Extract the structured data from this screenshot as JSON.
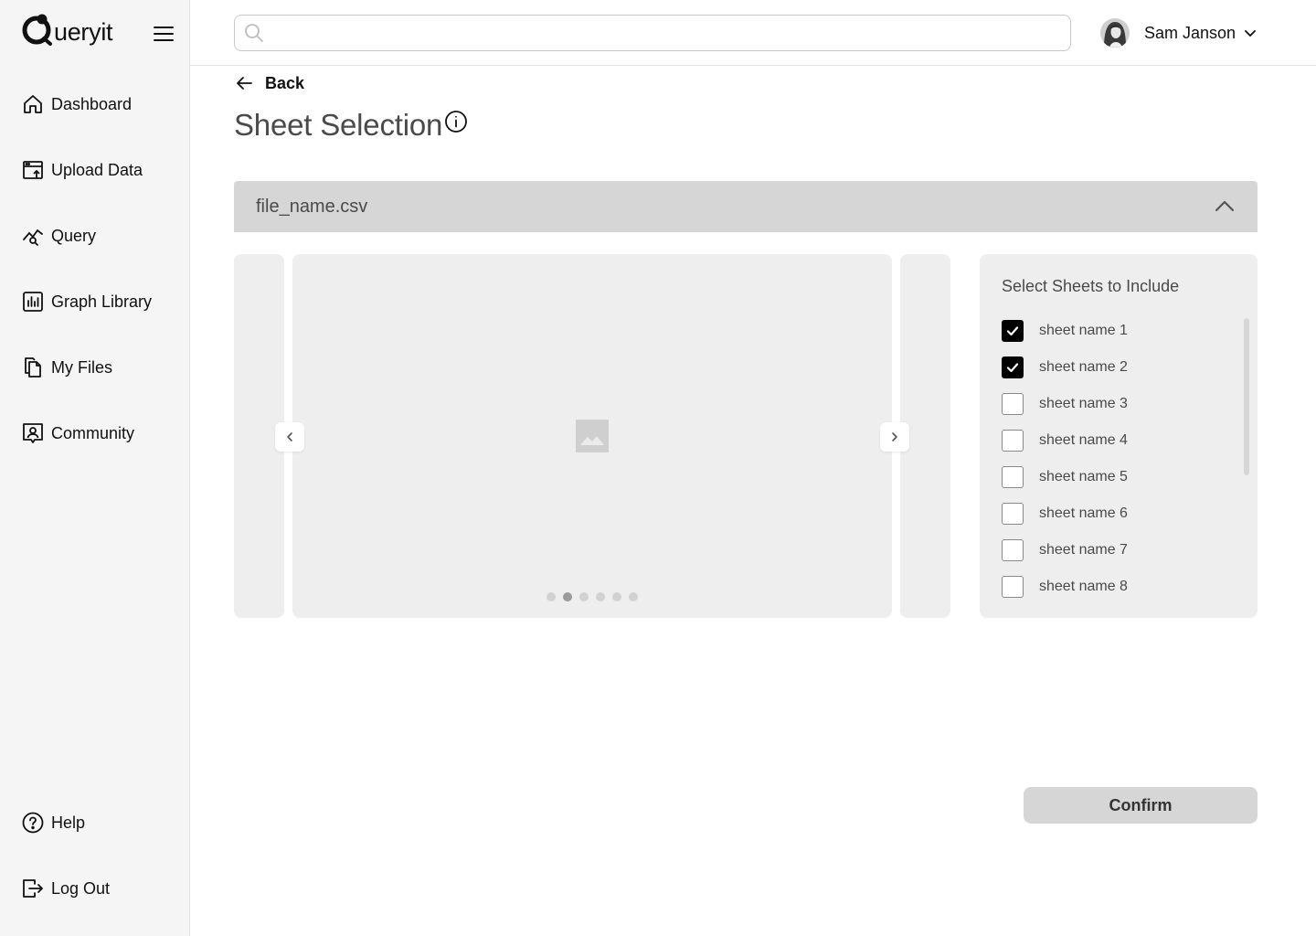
{
  "app": {
    "logo_text": "ueryit"
  },
  "sidebar": {
    "items": [
      {
        "label": "Dashboard",
        "icon": "home-icon"
      },
      {
        "label": "Upload Data",
        "icon": "upload-icon"
      },
      {
        "label": "Query",
        "icon": "query-icon"
      },
      {
        "label": "Graph Library",
        "icon": "graph-icon"
      },
      {
        "label": "My Files",
        "icon": "files-icon"
      },
      {
        "label": "Community",
        "icon": "community-icon"
      }
    ],
    "bottom": [
      {
        "label": "Help",
        "icon": "help-icon"
      },
      {
        "label": "Log Out",
        "icon": "logout-icon"
      }
    ]
  },
  "header": {
    "search_value": "",
    "user_name": "Sam Janson"
  },
  "main": {
    "back_label": "Back",
    "title": "Sheet Selection",
    "file_name": "file_name.csv",
    "carousel": {
      "slide_count": 6,
      "active_index": 1
    },
    "sheets_heading": "Select Sheets to Include",
    "sheets": [
      {
        "name": "sheet name 1",
        "checked": true
      },
      {
        "name": "sheet name 2",
        "checked": true
      },
      {
        "name": "sheet name 3",
        "checked": false
      },
      {
        "name": "sheet name 4",
        "checked": false
      },
      {
        "name": "sheet name 5",
        "checked": false
      },
      {
        "name": "sheet name 6",
        "checked": false
      },
      {
        "name": "sheet name 7",
        "checked": false
      },
      {
        "name": "sheet name 8",
        "checked": false
      }
    ],
    "confirm_label": "Confirm"
  },
  "colors": {
    "sidebar_bg": "#f5f5f5",
    "panel_bg": "#eeeeee",
    "file_bar_bg": "#d6d6d6",
    "checkbox_checked": "#000000",
    "button_bg": "#d6d6d6"
  }
}
